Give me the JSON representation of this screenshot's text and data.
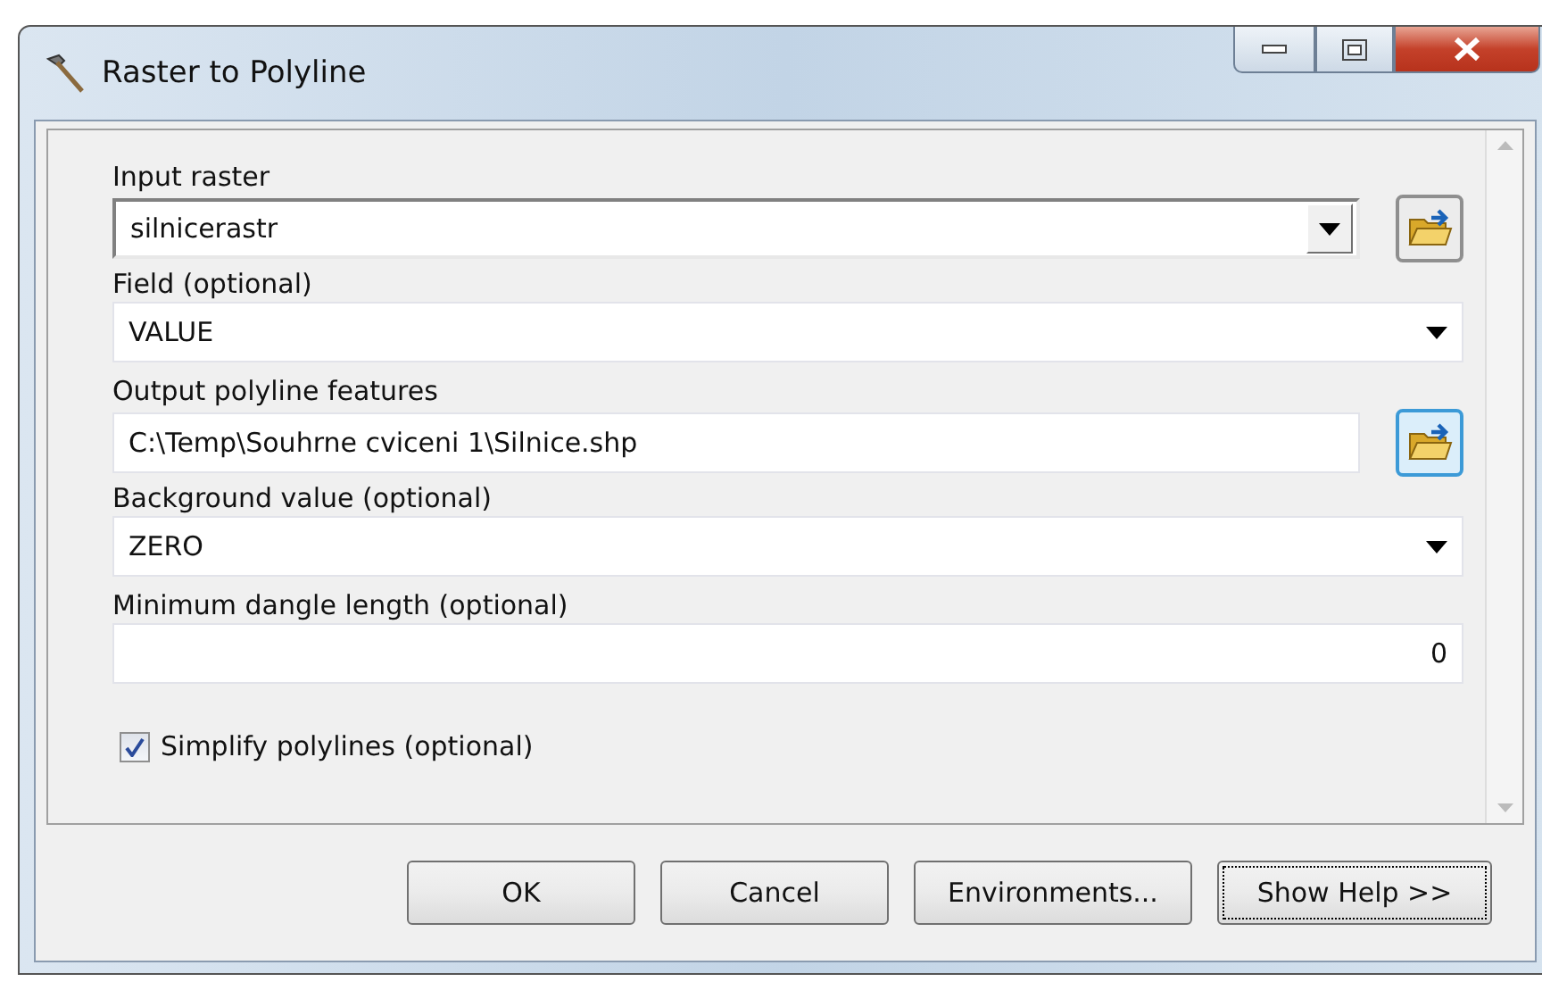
{
  "window": {
    "title": "Raster to Polyline"
  },
  "fields": [
    {
      "label": "Input raster",
      "kind": "combo",
      "value": "silnicerastr",
      "browse": true,
      "browse_focused": false
    },
    {
      "label": "Field (optional)",
      "kind": "dropdown",
      "value": "VALUE",
      "browse": false
    },
    {
      "label": "Output polyline features",
      "kind": "text",
      "value": "C:\\Temp\\Souhrne cviceni 1\\Silnice.shp",
      "browse": true,
      "browse_focused": true
    },
    {
      "label": "Background value (optional)",
      "kind": "dropdown",
      "value": "ZERO",
      "browse": false
    },
    {
      "label": "Minimum dangle length (optional)",
      "kind": "number",
      "value": "0",
      "browse": false
    }
  ],
  "checkbox": {
    "label": "Simplify polylines (optional)",
    "checked": true
  },
  "buttons": [
    {
      "label": "OK",
      "focused": false
    },
    {
      "label": "Cancel",
      "focused": false
    },
    {
      "label": "Environments...",
      "focused": false
    },
    {
      "label": "Show Help >>",
      "focused": true
    }
  ]
}
